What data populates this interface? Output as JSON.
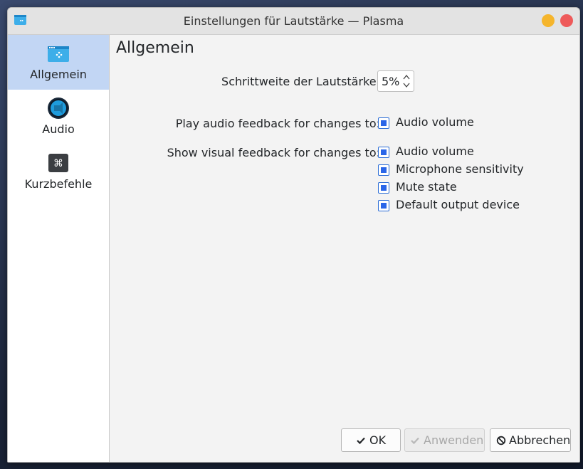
{
  "window": {
    "title": "Einstellungen für Lautstärke — Plasma",
    "controls": [
      "minimize-icon",
      "close-icon"
    ]
  },
  "sidebar": {
    "items": [
      {
        "label": "Allgemein",
        "icon": "settings-general-icon",
        "active": true
      },
      {
        "label": "Audio",
        "icon": "audio-icon",
        "active": false
      },
      {
        "label": "Kurzbefehle",
        "icon": "keyboard-shortcut-icon",
        "active": false
      }
    ]
  },
  "page": {
    "title": "Allgemein",
    "step": {
      "label": "Schrittweite der Lautstärke:",
      "value": "5%"
    },
    "audio_feedback": {
      "label": "Play audio feedback for changes to:",
      "options": [
        {
          "label": "Audio volume",
          "checked": true
        }
      ]
    },
    "visual_feedback": {
      "label": "Show visual feedback for changes to:",
      "options": [
        {
          "label": "Audio volume",
          "checked": true
        },
        {
          "label": "Microphone sensitivity",
          "checked": true
        },
        {
          "label": "Mute state",
          "checked": true
        },
        {
          "label": "Default output device",
          "checked": true
        }
      ]
    }
  },
  "buttons": {
    "ok": "OK",
    "apply": "Anwenden",
    "cancel": "Abbrechen"
  },
  "colors": {
    "accent": "#2a66e8",
    "active_bg": "#c2d6f4"
  }
}
